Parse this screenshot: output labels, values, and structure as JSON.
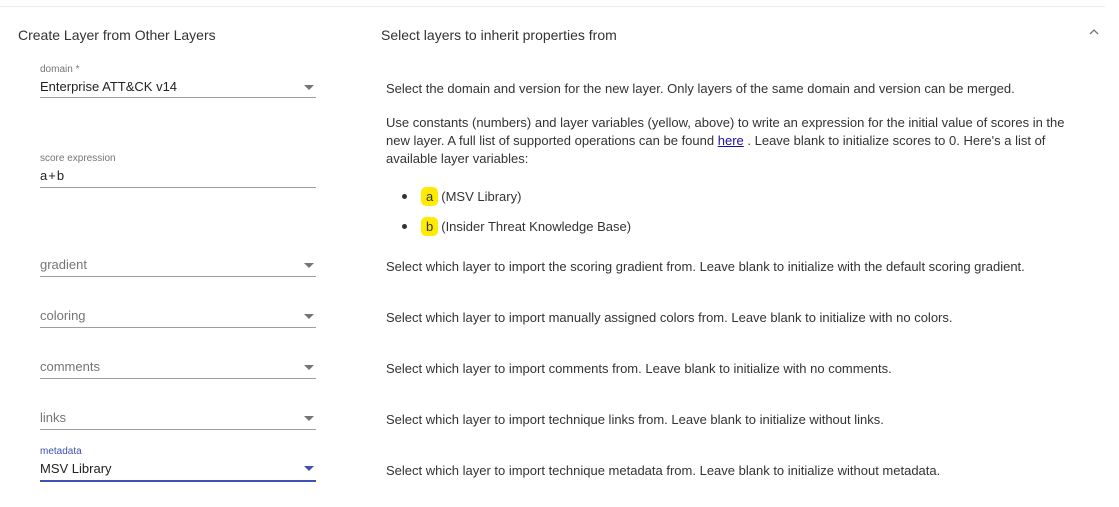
{
  "left_panel": {
    "title": "Create Layer from Other Layers"
  },
  "right_panel": {
    "title": "Select layers to inherit properties from"
  },
  "fields": {
    "domain": {
      "label": "domain *",
      "value": "Enterprise ATT&CK v14"
    },
    "score_expression": {
      "label": "score expression",
      "value": "a+b"
    },
    "gradient": {
      "placeholder": "gradient"
    },
    "coloring": {
      "placeholder": "coloring"
    },
    "comments": {
      "placeholder": "comments"
    },
    "links": {
      "placeholder": "links"
    },
    "metadata": {
      "label": "metadata",
      "value": "MSV Library"
    }
  },
  "descriptions": {
    "domain": "Select the domain and version for the new layer. Only layers of the same domain and version can be merged.",
    "score_part1": "Use constants (numbers) and layer variables (yellow, above) to write an expression for the initial value of scores in the new layer. A full list of supported operations can be found",
    "score_link": "here",
    "score_part2": ". Leave blank to initialize scores to 0. Here's a list of available layer variables:",
    "gradient": "Select which layer to import the scoring gradient from. Leave blank to initialize with the default scoring gradient.",
    "coloring": "Select which layer to import manually assigned colors from. Leave blank to initialize with no colors.",
    "comments": "Select which layer to import comments from. Leave blank to initialize with no comments.",
    "links": "Select which layer to import technique links from. Leave blank to initialize without links.",
    "metadata": "Select which layer to import technique metadata from. Leave blank to initialize without metadata."
  },
  "layer_variables": [
    {
      "var": "a",
      "name": "(MSV Library)"
    },
    {
      "var": "b",
      "name": "(Insider Threat Knowledge Base)"
    }
  ],
  "colors": {
    "accent": "#3f51b5",
    "variable_highlight": "#ffea00",
    "link": "#1a0dab"
  },
  "icons": {
    "collapse": "chevron-up-icon",
    "dropdown": "arrow-drop-down-icon"
  }
}
